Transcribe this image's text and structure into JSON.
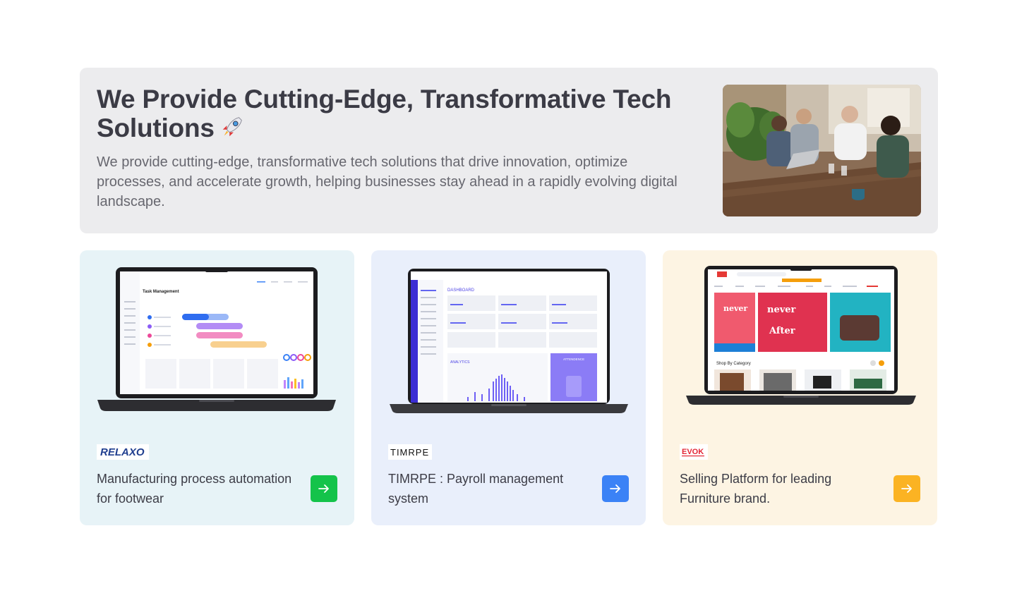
{
  "hero": {
    "title": "We Provide Cutting-Edge, Transformative Tech Solutions",
    "title_emoji_icon": "rocket-icon",
    "description": "We provide cutting-edge, transformative tech solutions that drive innovation, optimize processes, and accelerate growth, helping businesses stay ahead in a rapidly evolving digital landscape."
  },
  "cards": [
    {
      "logo": "RELAXO",
      "text": "Manufacturing process automation for footwear",
      "accent": "#14c34a",
      "screen": {
        "title": "Task Management"
      }
    },
    {
      "logo": "TIMRPE",
      "text": "TIMRPE : Payroll management system",
      "accent": "#3b82f6",
      "screen": {
        "title": "DASHBOARD",
        "section": "ANALYTICS",
        "panel": "ATTENDENCE"
      }
    },
    {
      "logo": "EVOK",
      "text": "Selling Platform for leading Furniture brand.",
      "accent": "#fbb323",
      "screen": {
        "section": "Shop By Category"
      }
    }
  ],
  "icons": {
    "arrow": "arrow-right-icon"
  }
}
